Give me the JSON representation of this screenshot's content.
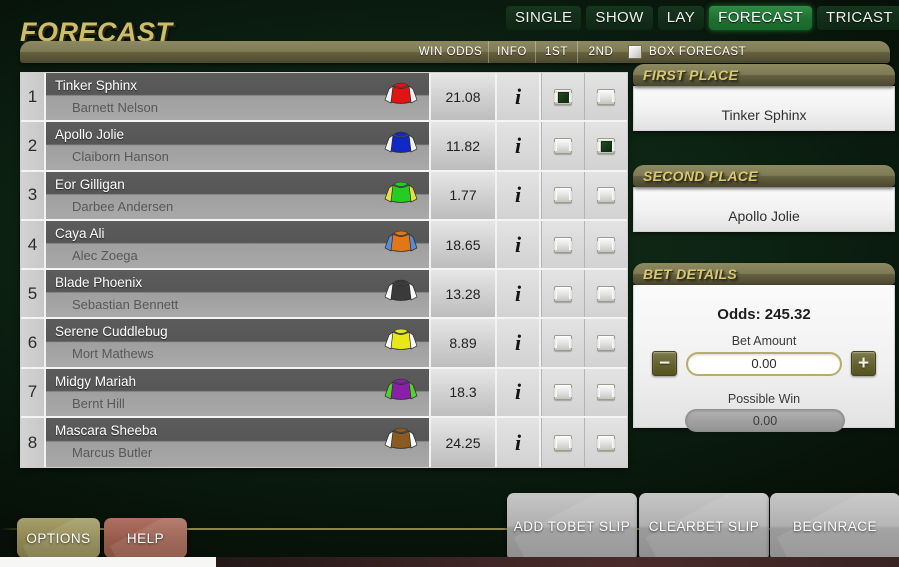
{
  "page_title": "FORECAST",
  "tabs": [
    {
      "label": "SINGLE",
      "active": false
    },
    {
      "label": "SHOW",
      "active": false
    },
    {
      "label": "LAY",
      "active": false
    },
    {
      "label": "FORECAST",
      "active": true
    },
    {
      "label": "TRICAST",
      "active": false
    }
  ],
  "columns": {
    "win_odds": "WIN ODDS",
    "info": "INFO",
    "first": "1ST",
    "second": "2ND",
    "box_forecast": "BOX FORECAST",
    "box_forecast_checked": false
  },
  "runners": [
    {
      "num": "1",
      "horse": "Tinker Sphinx",
      "jockey": "Barnett Nelson",
      "odds": "21.08",
      "silk_body": "#e01414",
      "silk_sleeve": "#f2f2f2",
      "first": true,
      "second": false
    },
    {
      "num": "2",
      "horse": "Apollo Jolie",
      "jockey": "Claiborn Hanson",
      "odds": "11.82",
      "silk_body": "#1028c8",
      "silk_sleeve": "#f2f2f2",
      "first": false,
      "second": true
    },
    {
      "num": "3",
      "horse": "Eor Gilligan",
      "jockey": "Darbee Andersen",
      "odds": "1.77",
      "silk_body": "#24cc24",
      "silk_sleeve": "#e8e03c",
      "first": false,
      "second": false
    },
    {
      "num": "4",
      "horse": "Caya Ali",
      "jockey": "Alec Zoega",
      "odds": "18.65",
      "silk_body": "#e07818",
      "silk_sleeve": "#5a8ad0",
      "first": false,
      "second": false
    },
    {
      "num": "5",
      "horse": "Blade Phoenix",
      "jockey": "Sebastian Bennett",
      "odds": "13.28",
      "silk_body": "#3a3a3a",
      "silk_sleeve": "#fafafa",
      "first": false,
      "second": false
    },
    {
      "num": "6",
      "horse": "Serene Cuddlebug",
      "jockey": "Mort Mathews",
      "odds": "8.89",
      "silk_body": "#e8e818",
      "silk_sleeve": "#fafafa",
      "first": false,
      "second": false
    },
    {
      "num": "7",
      "horse": "Midgy Mariah",
      "jockey": "Bernt Hill",
      "odds": "18.3",
      "silk_body": "#8a20a8",
      "silk_sleeve": "#54d030",
      "first": false,
      "second": false
    },
    {
      "num": "8",
      "horse": "Mascara Sheeba",
      "jockey": "Marcus Butler",
      "odds": "24.25",
      "silk_body": "#8a5a20",
      "silk_sleeve": "#fafafa",
      "first": false,
      "second": false
    }
  ],
  "first_place": {
    "title": "FIRST PLACE",
    "selection": "Tinker Sphinx"
  },
  "second_place": {
    "title": "SECOND PLACE",
    "selection": "Apollo Jolie"
  },
  "bet_details": {
    "title": "BET DETAILS",
    "odds_label": "Odds:  245.32",
    "amount_label": "Bet Amount",
    "amount_value": "0.00",
    "decrement": "−",
    "increment": "+",
    "possible_win_label": "Possible Win",
    "possible_win_value": "0.00"
  },
  "bottom": {
    "options": "OPTIONS",
    "help": "HELP",
    "add_to_bet_slip": "ADD TO\nBET SLIP",
    "clear_bet_slip": "CLEAR\nBET SLIP",
    "begin_race": "BEGIN\nRACE"
  },
  "colors": {
    "background": "#0c2112",
    "accent_gold": "#cdbd6a",
    "header_bar": "#7e7a55",
    "tab_active": "#2e8c43"
  }
}
